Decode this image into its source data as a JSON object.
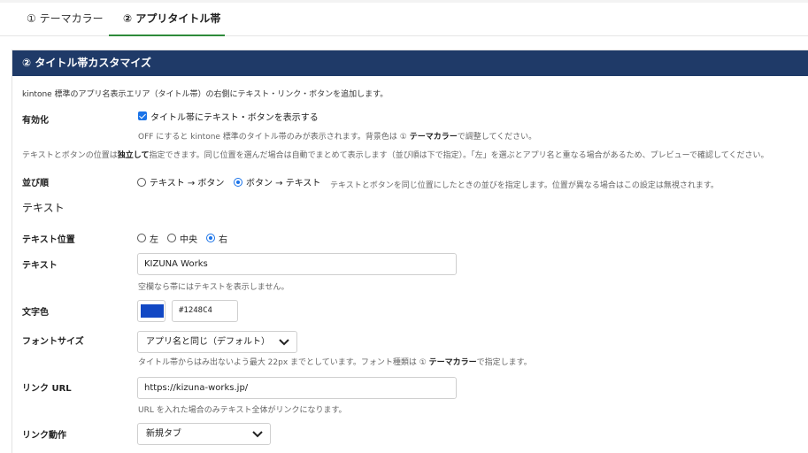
{
  "tabs": [
    {
      "label": "① テーマカラー"
    },
    {
      "label": "② アプリタイトル帯"
    }
  ],
  "panel": {
    "title": "② タイトル帯カスタマイズ",
    "intro": "kintone 標準のアプリ名表示エリア（タイトル帯）の右側にテキスト・リンク・ボタンを追加します。"
  },
  "enable": {
    "label": "有効化",
    "checkbox_label": "タイトル帯にテキスト・ボタンを表示する",
    "checked": true,
    "hint_prefix": "OFF にすると kintone 標準のタイトル帯のみが表示されます。背景色は ① ",
    "hint_bold": "テーマカラー",
    "hint_suffix": "で調整してください。"
  },
  "position_note": {
    "prefix": "テキストとボタンの位置は",
    "bold": "独立して",
    "suffix": "指定できます。同じ位置を選んだ場合は自動でまとめて表示します（並び順は下で指定）。「左」を選ぶとアプリ名と重なる場合があるため、プレビューで確認してください。"
  },
  "order": {
    "label": "並び順",
    "options": [
      "テキスト → ボタン",
      "ボタン → テキスト"
    ],
    "selected_index": 1,
    "hint": "テキストとボタンを同じ位置にしたときの並びを指定します。位置が異なる場合はこの設定は無視されます。"
  },
  "text_section": {
    "title": "テキスト"
  },
  "text_position": {
    "label": "テキスト位置",
    "options": [
      "左",
      "中央",
      "右"
    ],
    "selected_index": 2
  },
  "text": {
    "label": "テキスト",
    "value": "KIZUNA Works",
    "hint": "空欄なら帯にはテキストを表示しません。"
  },
  "text_color": {
    "label": "文字色",
    "value": "#1248C4",
    "color": "#1248c4"
  },
  "font_size": {
    "label": "フォントサイズ",
    "selected": "アプリ名と同じ（デフォルト）",
    "hint_prefix": "タイトル帯からはみ出ないよう最大 22px までとしています。フォント種類は ① ",
    "hint_bold": "テーマカラー",
    "hint_suffix": "で指定します。"
  },
  "link_url": {
    "label": "リンク URL",
    "value": "https://kizuna-works.jp/",
    "hint": "URL を入れた場合のみテキスト全体がリンクになります。"
  },
  "link_action": {
    "label": "リンク動作",
    "selected": "新規タブ"
  },
  "colors": {
    "header_bg": "#1f3a68",
    "tab_active_underline": "#2e8b3a",
    "accent": "#1a73e8"
  }
}
